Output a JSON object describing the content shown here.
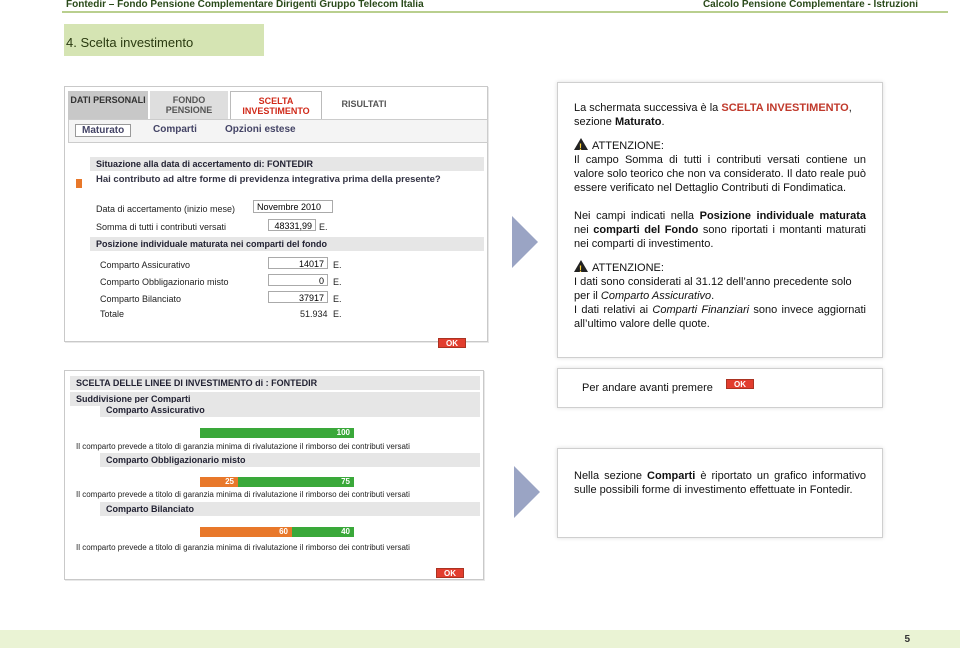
{
  "header": {
    "left": "Fontedir – Fondo Pensione Complementare Dirigenti Gruppo Telecom Italia",
    "right": "Calcolo Pensione Complementare - Istruzioni"
  },
  "section": {
    "title": "4.  Scelta investimento"
  },
  "screen1": {
    "tabs": [
      "DATI PERSONALI",
      "FONDO PENSIONE",
      "SCELTA INVESTIMENTO",
      "RISULTATI"
    ],
    "subtabs": [
      "Maturato",
      "Comparti",
      "Opzioni estese"
    ],
    "situation_label": "Situazione alla data di accertamento di: FONTEDIR",
    "question": "Hai contributo ad altre forme di previdenza integrativa prima della presente?",
    "date_label": "Data di accertamento (inizio mese)",
    "date_value": "Novembre 2010",
    "sum_label": "Somma di tutti i contributi versati",
    "sum_value": "48331,99",
    "sum_unit": "E.",
    "position_title": "Posizione individuale maturata nei comparti del fondo",
    "comparti": [
      {
        "label": "Comparto Assicurativo",
        "value": "14017",
        "unit": "E."
      },
      {
        "label": "Comparto Obbligazionario misto",
        "value": "0",
        "unit": "E."
      },
      {
        "label": "Comparto Bilanciato",
        "value": "37917",
        "unit": "E."
      }
    ],
    "total_label": "Totale",
    "total_value": "51.934",
    "total_unit": "E.",
    "ok": "OK"
  },
  "note1": {
    "p1_a": "La schermata successiva è la ",
    "p1_b": "SCELTA INVESTIMENTO",
    "p1_c": ", sezione ",
    "p1_d": "Maturato",
    "p1_e": ".",
    "attention": "ATTENZIONE:",
    "p2": "Il campo Somma di tutti i contributi versati contiene un valore solo teorico che non va considerato. Il dato reale può essere verificato nel Dettaglio Contributi di Fondimatica.",
    "p3_a": "Nei campi indicati nella ",
    "p3_b": "Posizione individuale maturata",
    "p3_c": " nei ",
    "p3_d": "comparti del Fondo",
    "p3_e": " sono riportati i montanti maturati nei comparti di investimento.",
    "attention2": "ATTENZIONE:",
    "p4_a": "I dati sono considerati al 31.12 dell’anno precedente solo per il ",
    "p4_b": "Comparto Assicurativo",
    "p4_c": ".",
    "p5_a": "I dati relativi ai ",
    "p5_b": "Comparti Finanziari",
    "p5_c": " sono invece aggiornati all’ultimo valore delle quote."
  },
  "note2": {
    "text": "Per andare avanti premere",
    "ok": "OK"
  },
  "screen2": {
    "title": "SCELTA DELLE LINEE DI INVESTIMENTO di : FONTEDIR",
    "subdivision": "Suddivisione per Comparti",
    "guarantee": "Il comparto prevede a titolo di garanzia minima di rivalutazione il rimborso dei contributi versati",
    "comparti": [
      {
        "name": "Comparto Assicurativo",
        "segments": [
          {
            "value": "100",
            "color": "#3aa83a"
          }
        ]
      },
      {
        "name": "Comparto Obbligazionario misto",
        "segments": [
          {
            "value": "25",
            "color": "#e8782a"
          },
          {
            "value": "75",
            "color": "#3aa83a"
          }
        ]
      },
      {
        "name": "Comparto Bilanciato",
        "segments": [
          {
            "value": "60",
            "color": "#e8782a"
          },
          {
            "value": "40",
            "color": "#3aa83a"
          }
        ]
      }
    ],
    "ok": "OK"
  },
  "note3": {
    "a": "Nella sezione ",
    "b": "Comparti",
    "c": " è riportato un grafico informativo sulle possibili forme di investimento effettuate in Fontedir."
  },
  "page_number": "5"
}
